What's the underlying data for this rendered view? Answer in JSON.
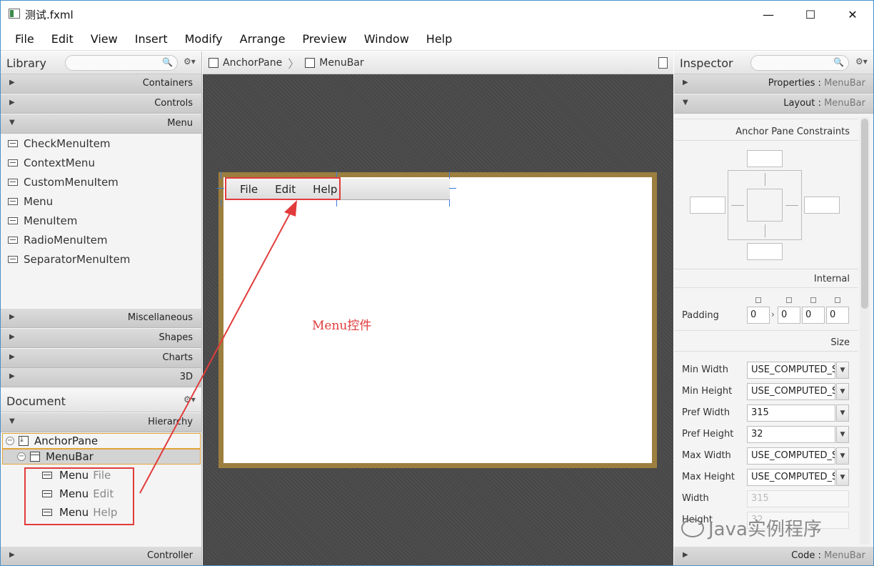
{
  "window": {
    "title": "测试.fxml",
    "minimize": "—",
    "maximize": "☐",
    "close": "✕"
  },
  "menubar": [
    "File",
    "Edit",
    "View",
    "Insert",
    "Modify",
    "Arrange",
    "Preview",
    "Window",
    "Help"
  ],
  "library": {
    "title": "Library",
    "sections_top": [
      "Containers",
      "Controls",
      "Menu"
    ],
    "items": [
      "CheckMenuItem",
      "ContextMenu",
      "CustomMenuItem",
      "Menu",
      "MenuItem",
      "RadioMenuItem",
      "SeparatorMenuItem"
    ],
    "sections_bottom": [
      "Miscellaneous",
      "Shapes",
      "Charts",
      "3D"
    ]
  },
  "document": {
    "title": "Document",
    "hierarchy_label": "Hierarchy",
    "root": "AnchorPane",
    "child": "MenuBar",
    "menus": [
      {
        "kind": "Menu",
        "name": "File"
      },
      {
        "kind": "Menu",
        "name": "Edit"
      },
      {
        "kind": "Menu",
        "name": "Help"
      }
    ],
    "controller_label": "Controller"
  },
  "breadcrumb": [
    "AnchorPane",
    "MenuBar"
  ],
  "canvas": {
    "menus": [
      "File",
      "Edit",
      "Help"
    ],
    "annotation": "Menu控件"
  },
  "inspector": {
    "title": "Inspector",
    "properties": {
      "label": "Properties",
      "target": "MenuBar"
    },
    "layout": {
      "label": "Layout",
      "target": "MenuBar"
    },
    "anchor_title": "Anchor Pane Constraints",
    "internal_title": "Internal",
    "padding": {
      "label": "Padding",
      "values": [
        "0",
        "0",
        "0",
        "0"
      ],
      "arrow": "›"
    },
    "size_title": "Size",
    "size_rows": [
      {
        "label": "Min Width",
        "value": "USE_COMPUTED_SIZE"
      },
      {
        "label": "Min Height",
        "value": "USE_COMPUTED_SIZE"
      },
      {
        "label": "Pref Width",
        "value": "315"
      },
      {
        "label": "Pref Height",
        "value": "32"
      },
      {
        "label": "Max Width",
        "value": "USE_COMPUTED_SIZE"
      },
      {
        "label": "Max Height",
        "value": "USE_COMPUTED_SIZE"
      }
    ],
    "width": {
      "label": "Width",
      "value": "315"
    },
    "height": {
      "label": "Height",
      "value": "32"
    },
    "code": {
      "label": "Code",
      "target": "MenuBar"
    }
  },
  "watermark": "Java实例程序",
  "icons": {
    "search": "search-icon",
    "gear": "gear-icon",
    "collapse": "minus-circle-icon"
  }
}
